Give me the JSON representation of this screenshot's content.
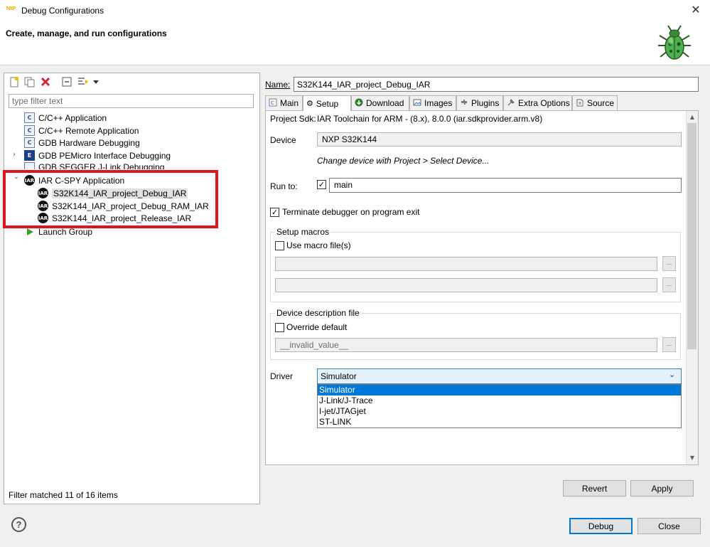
{
  "window": {
    "logo_text": "NXP",
    "title": "Debug Configurations",
    "close_glyph": "✕",
    "header_title": "Create, manage, and run configurations"
  },
  "left": {
    "toolbar": [
      {
        "icon": "new-configuration-icon"
      },
      {
        "icon": "duplicate-icon"
      },
      {
        "icon": "delete-icon"
      },
      {
        "icon": "collapse-all-icon"
      },
      {
        "icon": "filter-icon"
      },
      {
        "icon": "view-menu-icon"
      }
    ],
    "filter_placeholder": "type filter text",
    "tree": [
      {
        "label": "C/C++ Application",
        "icon": "c-app-icon",
        "glyph": "C"
      },
      {
        "label": "C/C++ Remote Application",
        "icon": "c-app-icon",
        "glyph": "C"
      },
      {
        "label": "GDB Hardware Debugging",
        "icon": "c-app-icon",
        "glyph": "C"
      },
      {
        "label": "GDB PEMicro Interface Debugging",
        "icon": "pemicro-icon",
        "glyph": "E"
      },
      {
        "label": "GDB SEGGER J-Link Debugging",
        "icon": "segger-icon"
      },
      {
        "label": "IAR C-SPY Application",
        "icon": "iar-icon",
        "glyph": "IAR"
      },
      {
        "label": "S32K144_IAR_project_Debug_IAR",
        "icon": "iar-icon",
        "glyph": "IAR"
      },
      {
        "label": "S32K144_IAR_project_Debug_RAM_IAR",
        "icon": "iar-icon",
        "glyph": "IAR"
      },
      {
        "label": "S32K144_IAR_project_Release_IAR",
        "icon": "iar-icon",
        "glyph": "IAR"
      },
      {
        "label": "Launch Group",
        "icon": "launch-group-icon"
      }
    ],
    "status": "Filter matched 11 of 16 items"
  },
  "right": {
    "name_label": "Name:",
    "name_value": "S32K144_IAR_project_Debug_IAR",
    "tabs": [
      {
        "label": "Main",
        "icon": "main-tab-icon"
      },
      {
        "label": "Setup",
        "icon": "gear-icon",
        "active": true
      },
      {
        "label": "Download",
        "icon": "download-icon"
      },
      {
        "label": "Images",
        "icon": "images-icon"
      },
      {
        "label": "Plugins",
        "icon": "plugins-icon"
      },
      {
        "label": "Extra Options",
        "icon": "extra-options-icon"
      },
      {
        "label": "Source",
        "icon": "source-icon"
      }
    ],
    "setup": {
      "sdk_label": "Project Sdk:",
      "sdk_value": "IAR Toolchain for ARM - (8.x), 8.0.0 (iar.sdkprovider.arm.v8)",
      "device_label": "Device",
      "device_value": "NXP S32K144",
      "device_hint": "Change device with Project > Select Device...",
      "run_to_label": "Run to:",
      "run_to_checked": true,
      "run_to_value": "main",
      "terminate_label": "Terminate debugger on program exit",
      "terminate_checked": true,
      "macros_title": "Setup macros",
      "use_macro_label": "Use macro file(s)",
      "use_macro_checked": false,
      "browse_label": "...",
      "ddf_title": "Device description file",
      "override_label": "Override default",
      "override_checked": false,
      "ddf_value": "__invalid_value__",
      "driver_label": "Driver",
      "driver_selected": "Simulator",
      "driver_options": [
        "Simulator",
        "J-Link/J-Trace",
        "I-jet/JTAGjet",
        "ST-LINK"
      ]
    },
    "revert_label": "Revert",
    "apply_label": "Apply"
  },
  "footer": {
    "help_glyph": "?",
    "debug_label": "Debug",
    "close_label": "Close"
  },
  "colors": {
    "highlight_border": "#e0141e",
    "selection_blue": "#0078d7",
    "bug_green": "#4caf50"
  }
}
